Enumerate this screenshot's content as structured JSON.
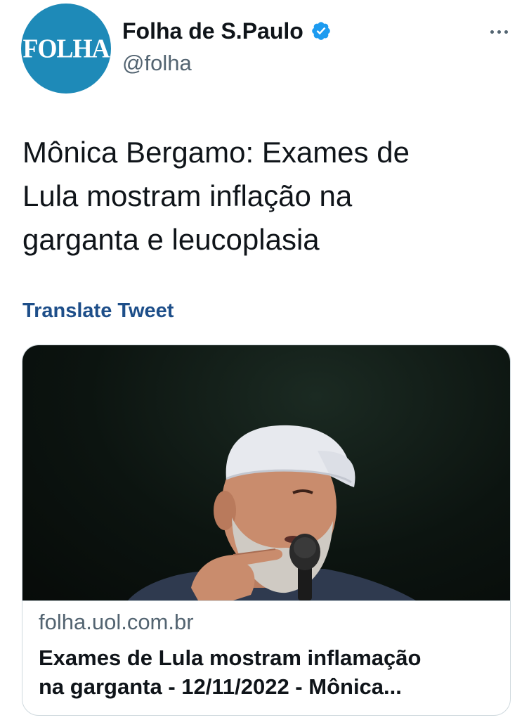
{
  "author": {
    "avatar_text": "FOLHA",
    "display_name": "Folha de S.Paulo",
    "handle": "@folha",
    "verified": true
  },
  "tweet": {
    "text": "Mônica Bergamo: Exames de\nLula mostram inflação na\ngarganta e leucoplasia",
    "translate_label": "Translate Tweet"
  },
  "card": {
    "domain": "folha.uol.com.br",
    "title_line1": "Exames de Lula mostram inflamação",
    "title_line2": "na garganta - 12/11/2022 - Mônica..."
  },
  "colors": {
    "avatar_bg": "#1e8ab8",
    "verified": "#1d9bf0",
    "translate_link": "#1d4e89",
    "secondary_text": "#536471"
  },
  "icons": {
    "more": "more-horizontal-icon",
    "verified": "verified-badge-icon"
  }
}
